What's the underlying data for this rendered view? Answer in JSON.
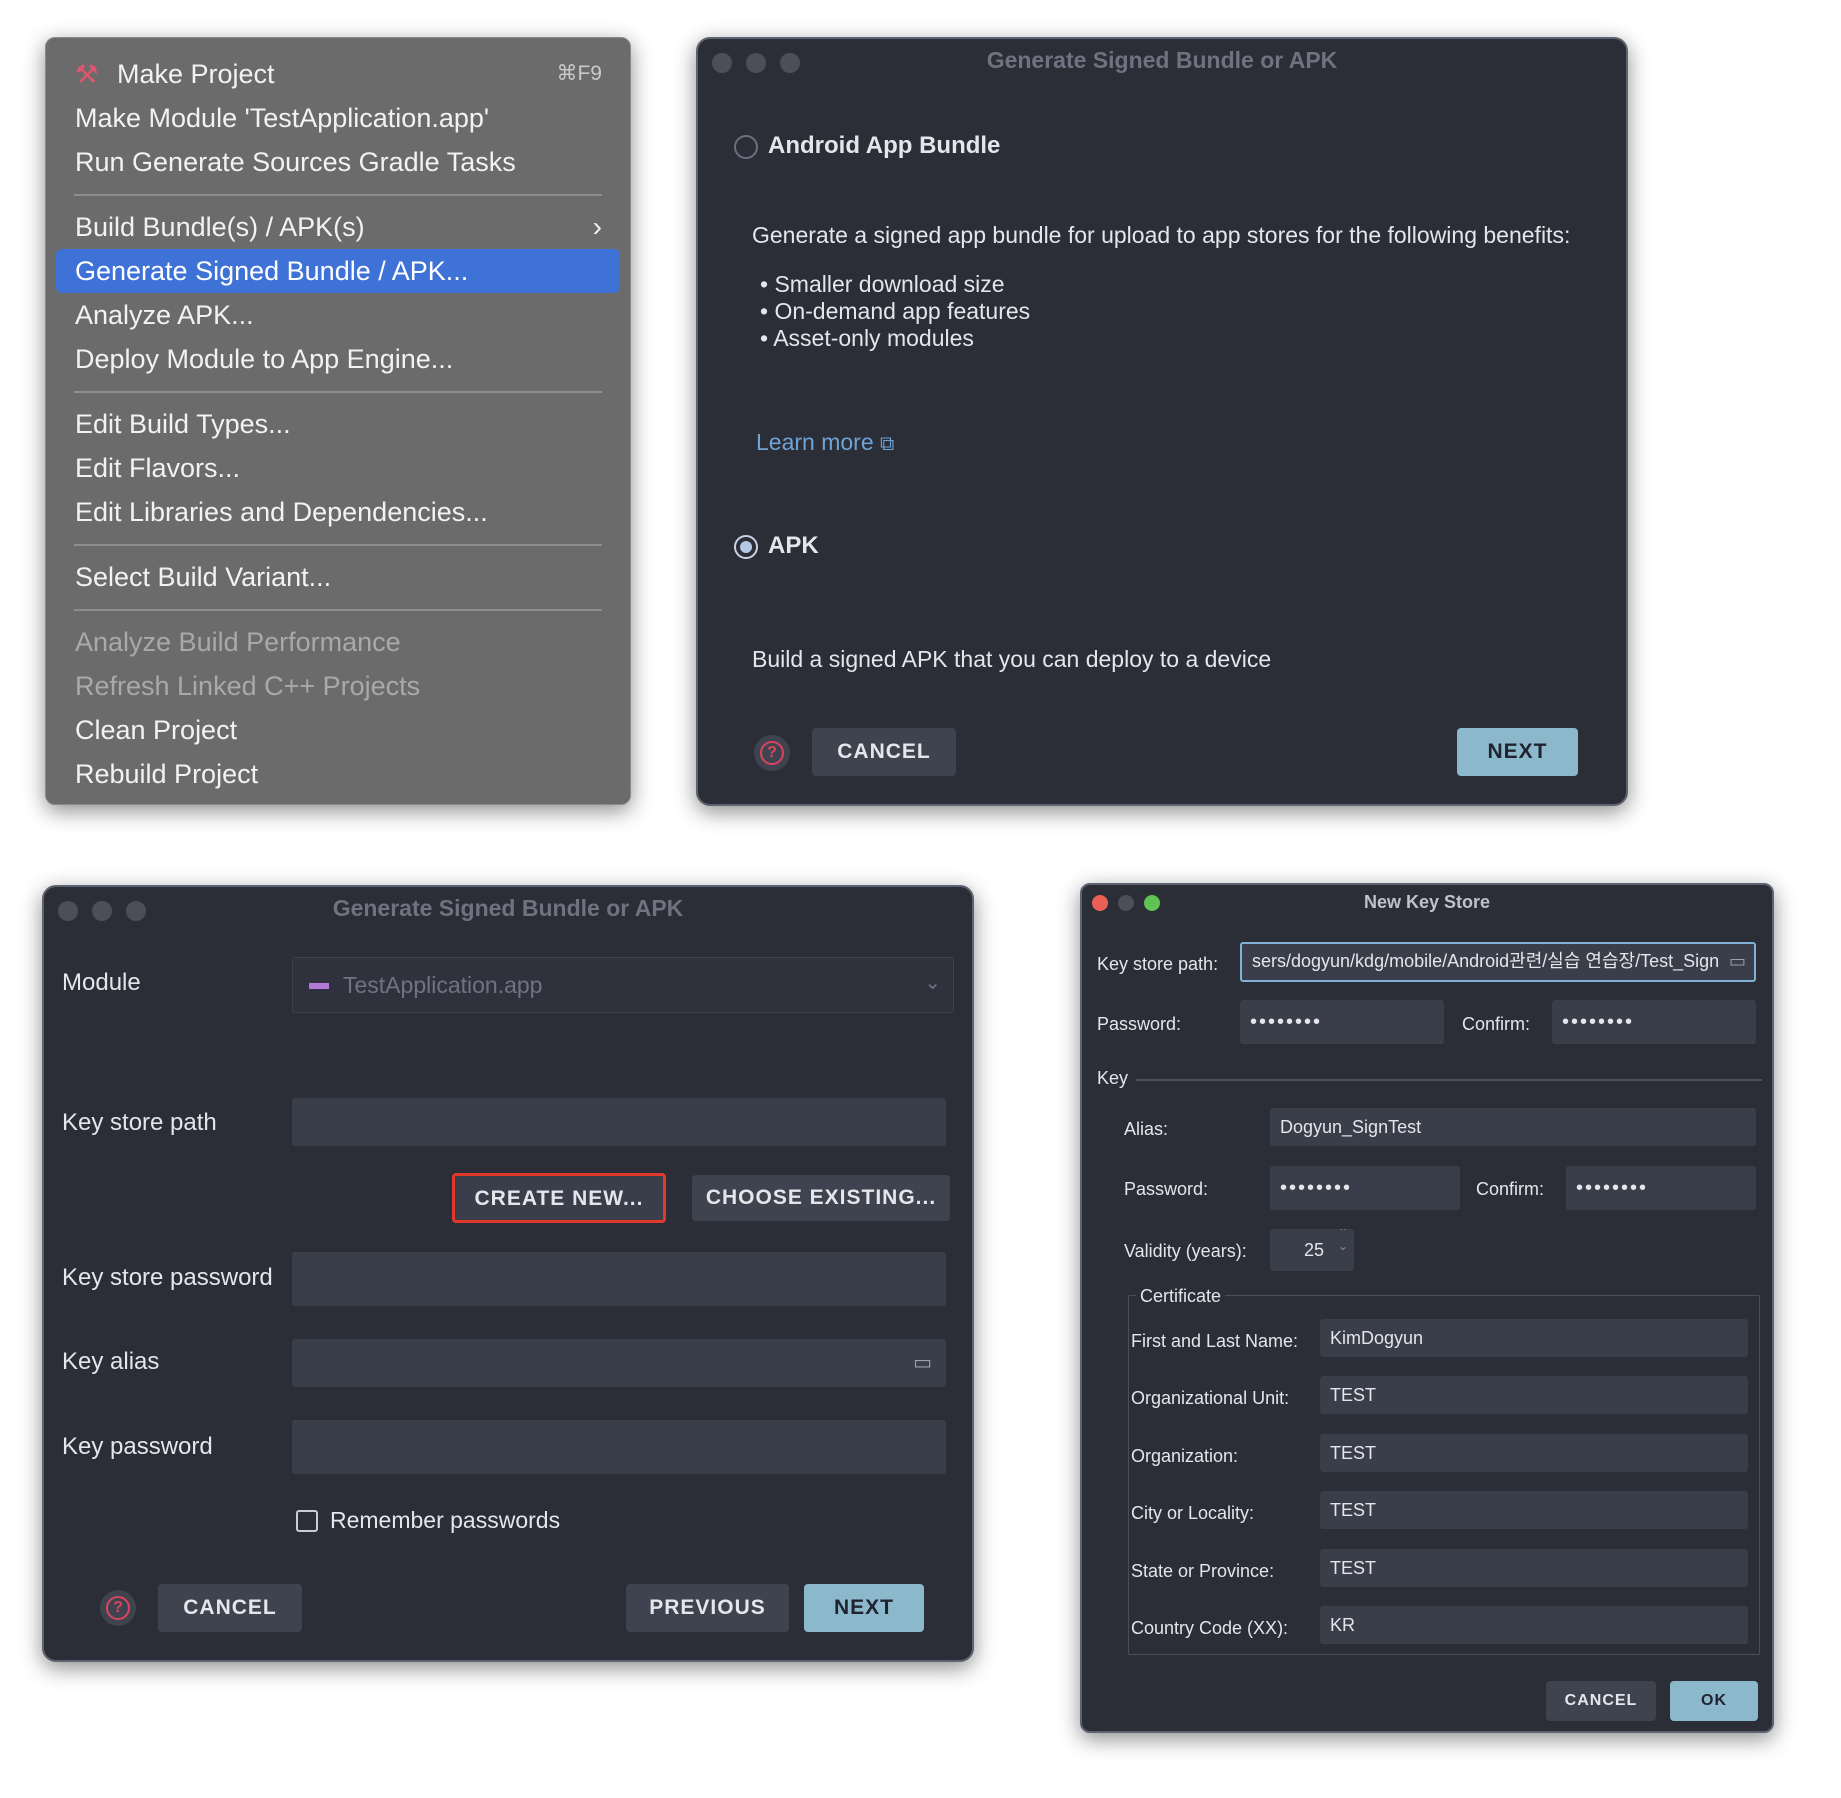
{
  "build_menu": {
    "items": [
      {
        "label": "Make Project",
        "shortcut": "⌘F9"
      },
      {
        "label": "Make Module 'TestApplication.app'"
      },
      {
        "label": "Run Generate Sources Gradle Tasks"
      },
      {
        "label": "Build Bundle(s) / APK(s)"
      },
      {
        "label": "Generate Signed Bundle / APK..."
      },
      {
        "label": "Analyze APK..."
      },
      {
        "label": "Deploy Module to App Engine..."
      },
      {
        "label": "Edit Build Types..."
      },
      {
        "label": "Edit Flavors..."
      },
      {
        "label": "Edit Libraries and Dependencies..."
      },
      {
        "label": "Select Build Variant..."
      },
      {
        "label": "Analyze Build Performance"
      },
      {
        "label": "Refresh Linked C++ Projects"
      },
      {
        "label": "Clean Project"
      },
      {
        "label": "Rebuild Project"
      }
    ]
  },
  "dialog_choose": {
    "title": "Generate Signed Bundle or APK",
    "bundle_option": "Android App Bundle",
    "bundle_desc": "Generate a signed app bundle for upload to app stores for the following benefits:",
    "benefits": [
      "Smaller download size",
      "On-demand app features",
      "Asset-only modules"
    ],
    "learn_more": "Learn more",
    "apk_option": "APK",
    "apk_desc": "Build a signed APK that you can deploy to a device",
    "cancel": "CANCEL",
    "next": "NEXT"
  },
  "dialog_keystore": {
    "title": "Generate Signed Bundle or APK",
    "module_label": "Module",
    "module_value": "TestApplication.app",
    "key_store_path_label": "Key store path",
    "create_new": "CREATE NEW...",
    "choose_existing": "CHOOSE EXISTING...",
    "key_store_password_label": "Key store password",
    "key_alias_label": "Key alias",
    "key_password_label": "Key password",
    "remember_passwords": "Remember passwords",
    "cancel": "CANCEL",
    "previous": "PREVIOUS",
    "next": "NEXT"
  },
  "dialog_new_key_store": {
    "title": "New Key Store",
    "key_store_path_label": "Key store path:",
    "key_store_path_value": "sers/dogyun/kdg/mobile/Android관련/실습 연습장/Test_Sign",
    "password_label": "Password:",
    "password_value": "••••••••",
    "confirm_label": "Confirm:",
    "confirm_value": "••••••••",
    "key_section": "Key",
    "alias_label": "Alias:",
    "alias_value": "Dogyun_SignTest",
    "key_password_label": "Password:",
    "key_password_value": "••••••••",
    "key_confirm_label": "Confirm:",
    "key_confirm_value": "••••••••",
    "validity_label": "Validity (years):",
    "validity_value": "25",
    "certificate_section": "Certificate",
    "first_last_label": "First and Last Name:",
    "first_last_value": "KimDogyun",
    "org_unit_label": "Organizational Unit:",
    "org_unit_value": "TEST",
    "organization_label": "Organization:",
    "organization_value": "TEST",
    "city_label": "City or Locality:",
    "city_value": "TEST",
    "state_label": "State or Province:",
    "state_value": "TEST",
    "country_label": "Country Code (XX):",
    "country_value": "KR",
    "cancel": "CANCEL",
    "ok": "OK"
  },
  "colors": {
    "menu_bg": "#6b6b6b",
    "menu_selected": "#3f72d6",
    "dialog_bg": "#2b2d37",
    "primary_button": "#8cb8cb",
    "link": "#6fa3d6",
    "highlight_box": "#e0392b"
  }
}
